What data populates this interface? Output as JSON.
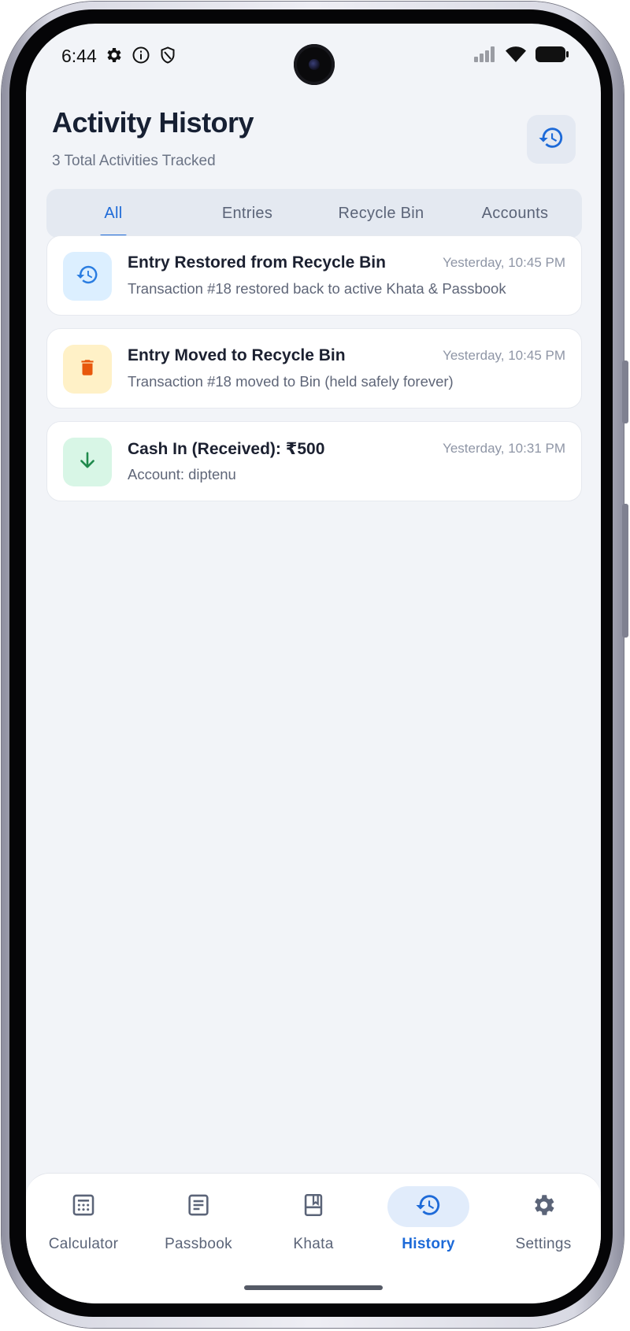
{
  "status_bar": {
    "time": "6:44",
    "left_icons": [
      "gear-icon",
      "info-icon",
      "shield-icon"
    ],
    "right_icons": [
      "signal-icon",
      "wifi-icon",
      "battery-icon"
    ]
  },
  "header": {
    "title": "Activity History",
    "subtitle": "3 Total Activities Tracked",
    "action_icon": "history-icon"
  },
  "tabs": [
    {
      "label": "All",
      "active": true
    },
    {
      "label": "Entries",
      "active": false
    },
    {
      "label": "Recycle Bin",
      "active": false
    },
    {
      "label": "Accounts",
      "active": false
    }
  ],
  "activities": [
    {
      "title": "Entry Restored from Recycle Bin",
      "time": "Yesterday, 10:45 PM",
      "description": "Transaction #18 restored back to active Khata & Passbook",
      "icon": "restore-icon",
      "icon_bg": "#dcefff",
      "icon_color": "#2a7de1"
    },
    {
      "title": "Entry Moved to Recycle Bin",
      "time": "Yesterday, 10:45 PM",
      "description": "Transaction #18 moved to Bin (held safely forever)",
      "icon": "trash-icon",
      "icon_bg": "#fff1c7",
      "icon_color": "#e8580c"
    },
    {
      "title": "Cash In (Received): ₹500",
      "time": "Yesterday, 10:31 PM",
      "description": "Account: diptenu",
      "icon": "arrow-down-icon",
      "icon_bg": "#d8f6e6",
      "icon_color": "#1f8a4c"
    }
  ],
  "bottom_nav": [
    {
      "label": "Calculator",
      "icon": "calculator-icon",
      "active": false
    },
    {
      "label": "Passbook",
      "icon": "passbook-icon",
      "active": false
    },
    {
      "label": "Khata",
      "icon": "book-icon",
      "active": false
    },
    {
      "label": "History",
      "icon": "history-icon",
      "active": true
    },
    {
      "label": "Settings",
      "icon": "gear-icon",
      "active": false
    }
  ],
  "colors": {
    "accent": "#1d6ad8",
    "background": "#f2f4f8",
    "title": "#172033"
  }
}
